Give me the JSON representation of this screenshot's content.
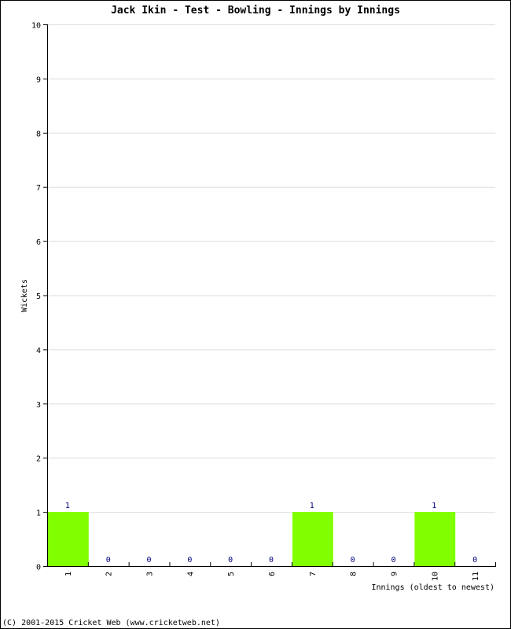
{
  "chart_data": {
    "type": "bar",
    "title": "Jack Ikin - Test - Bowling - Innings by Innings",
    "xlabel": "Innings (oldest to newest)",
    "ylabel": "Wickets",
    "categories": [
      "1",
      "2",
      "3",
      "4",
      "5",
      "6",
      "7",
      "8",
      "9",
      "10",
      "11"
    ],
    "values": [
      1,
      0,
      0,
      0,
      0,
      0,
      1,
      0,
      0,
      1,
      0
    ],
    "ylim": [
      0,
      10
    ],
    "yticks": [
      0,
      1,
      2,
      3,
      4,
      5,
      6,
      7,
      8,
      9,
      10
    ],
    "grid": true,
    "bar_color": "#80ff00",
    "label_color": "#000080"
  },
  "footer": "(C) 2001-2015 Cricket Web (www.cricketweb.net)"
}
